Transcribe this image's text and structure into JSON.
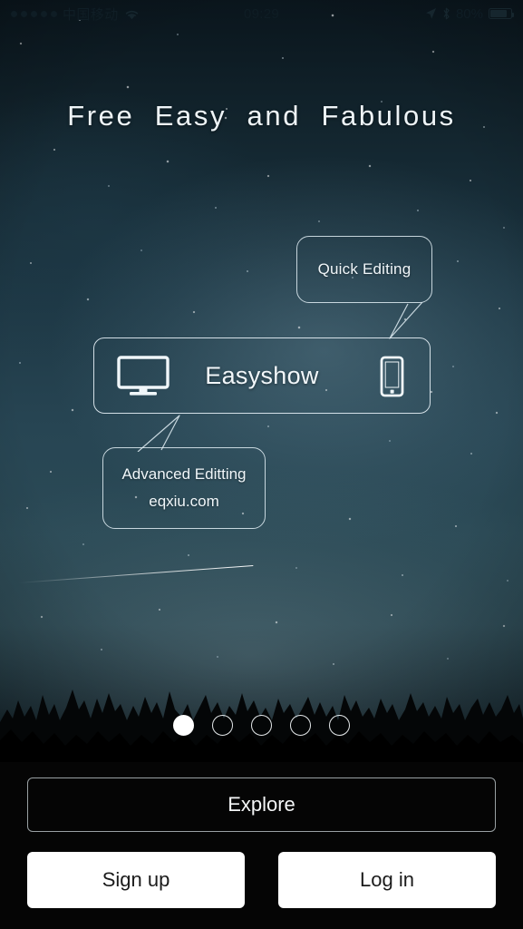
{
  "statusbar": {
    "signal_dots": 5,
    "carrier": "中国移动",
    "wifi_icon": "wifi-icon",
    "time": "09:29",
    "location_icon": "location-arrow-icon",
    "bluetooth_icon": "bluetooth-icon",
    "battery_percent": "80%",
    "battery_level": 80
  },
  "headline": "Free  Easy  and  Fabulous",
  "bubbles": {
    "top": {
      "text": "Quick Editing"
    },
    "bottom": {
      "line1": "Advanced Editting",
      "line2": "eqxiu.com"
    }
  },
  "card": {
    "label": "Easyshow",
    "left_icon": "monitor-icon",
    "right_icon": "mobile-phone-icon"
  },
  "pagination": {
    "count": 5,
    "active_index": 0
  },
  "buttons": {
    "explore": "Explore",
    "sign_up": "Sign up",
    "log_in": "Log in"
  },
  "colors": {
    "sky_dark": "#0a151c",
    "sky_mid": "#2b4a56",
    "ground": "#050505",
    "outline": "#e6f0f6",
    "button_white": "#ffffff",
    "button_text_dark": "#1b1b1b"
  }
}
